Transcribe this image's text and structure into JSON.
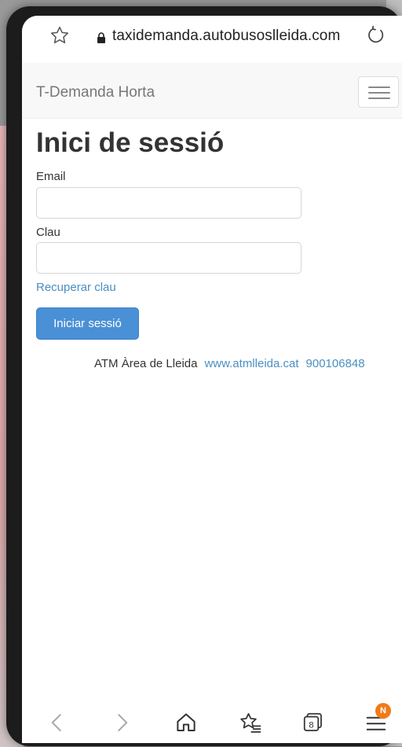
{
  "browser": {
    "url": "taxidemanda.autobusoslleida.com"
  },
  "navbar": {
    "brand": "T-Demanda Horta"
  },
  "login": {
    "title": "Inici de sessió",
    "email_label": "Email",
    "email_value": "",
    "password_label": "Clau",
    "password_value": "",
    "recover_link": "Recuperar clau",
    "submit_label": "Iniciar sessió"
  },
  "footer": {
    "org": "ATM Àrea de Lleida",
    "website": "www.atmlleida.cat",
    "phone": "900106848"
  },
  "bottom_bar": {
    "tabs_count": "8",
    "menu_badge": "N"
  },
  "colors": {
    "link": "#4a90c2",
    "primary_button": "#4a90d6",
    "badge": "#f07b18"
  },
  "icons": [
    "star-icon",
    "lock-icon",
    "reload-icon",
    "hamburger-icon",
    "back-icon",
    "forward-icon",
    "home-icon",
    "bookmarks-icon",
    "tabs-icon",
    "menu-icon"
  ]
}
